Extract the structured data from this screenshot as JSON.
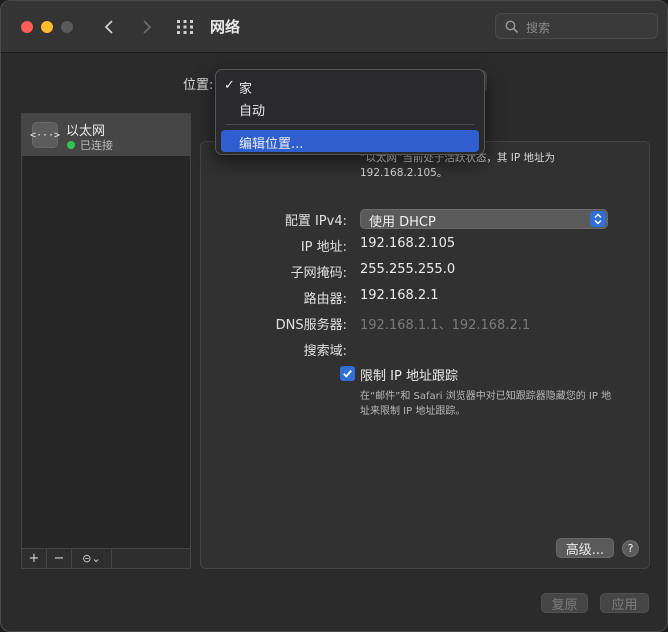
{
  "window": {
    "title": "网络",
    "search_placeholder": "搜索"
  },
  "location": {
    "label": "位置:",
    "menu": [
      {
        "label": "家",
        "checked": true
      },
      {
        "label": "自动",
        "checked": false
      },
      {
        "label": "编辑位置...",
        "checked": false,
        "highlighted": true
      }
    ],
    "check_mark": "✓"
  },
  "sidebar": {
    "items": [
      {
        "name": "以太网",
        "status": "已连接",
        "icon": "ethernet-icon",
        "icon_glyph": "<···>",
        "status_color": "#30c552"
      }
    ],
    "toolbar": {
      "add": "+",
      "remove": "−",
      "action": "⊝⌄"
    }
  },
  "detail": {
    "status_desc": "“以太网”当前处于活跃状态，其 IP 地址为 192.168.2.105。",
    "configure_label": "配置 IPv4:",
    "configure_value": "使用 DHCP",
    "ip_label": "IP 地址:",
    "ip_value": "192.168.2.105",
    "subnet_label": "子网掩码:",
    "subnet_value": "255.255.255.0",
    "router_label": "路由器:",
    "router_value": "192.168.2.1",
    "dns_label": "DNS服务器:",
    "dns_value": "192.168.1.1、192.168.2.1",
    "search_domain_label": "搜索域:",
    "limit_ip_label": "限制 IP 地址跟踪",
    "limit_ip_checked": true,
    "limit_ip_desc": "在“邮件”和 Safari 浏览器中对已知跟踪器隐藏您的 IP 地址来限制 IP 地址跟踪。",
    "advanced_button": "高级...",
    "help_button": "?"
  },
  "footer": {
    "revert_button": "复原",
    "apply_button": "应用"
  },
  "colors": {
    "accent": "#2f6fd6",
    "menu_highlight": "#2f5fcf",
    "connected": "#30c552"
  }
}
